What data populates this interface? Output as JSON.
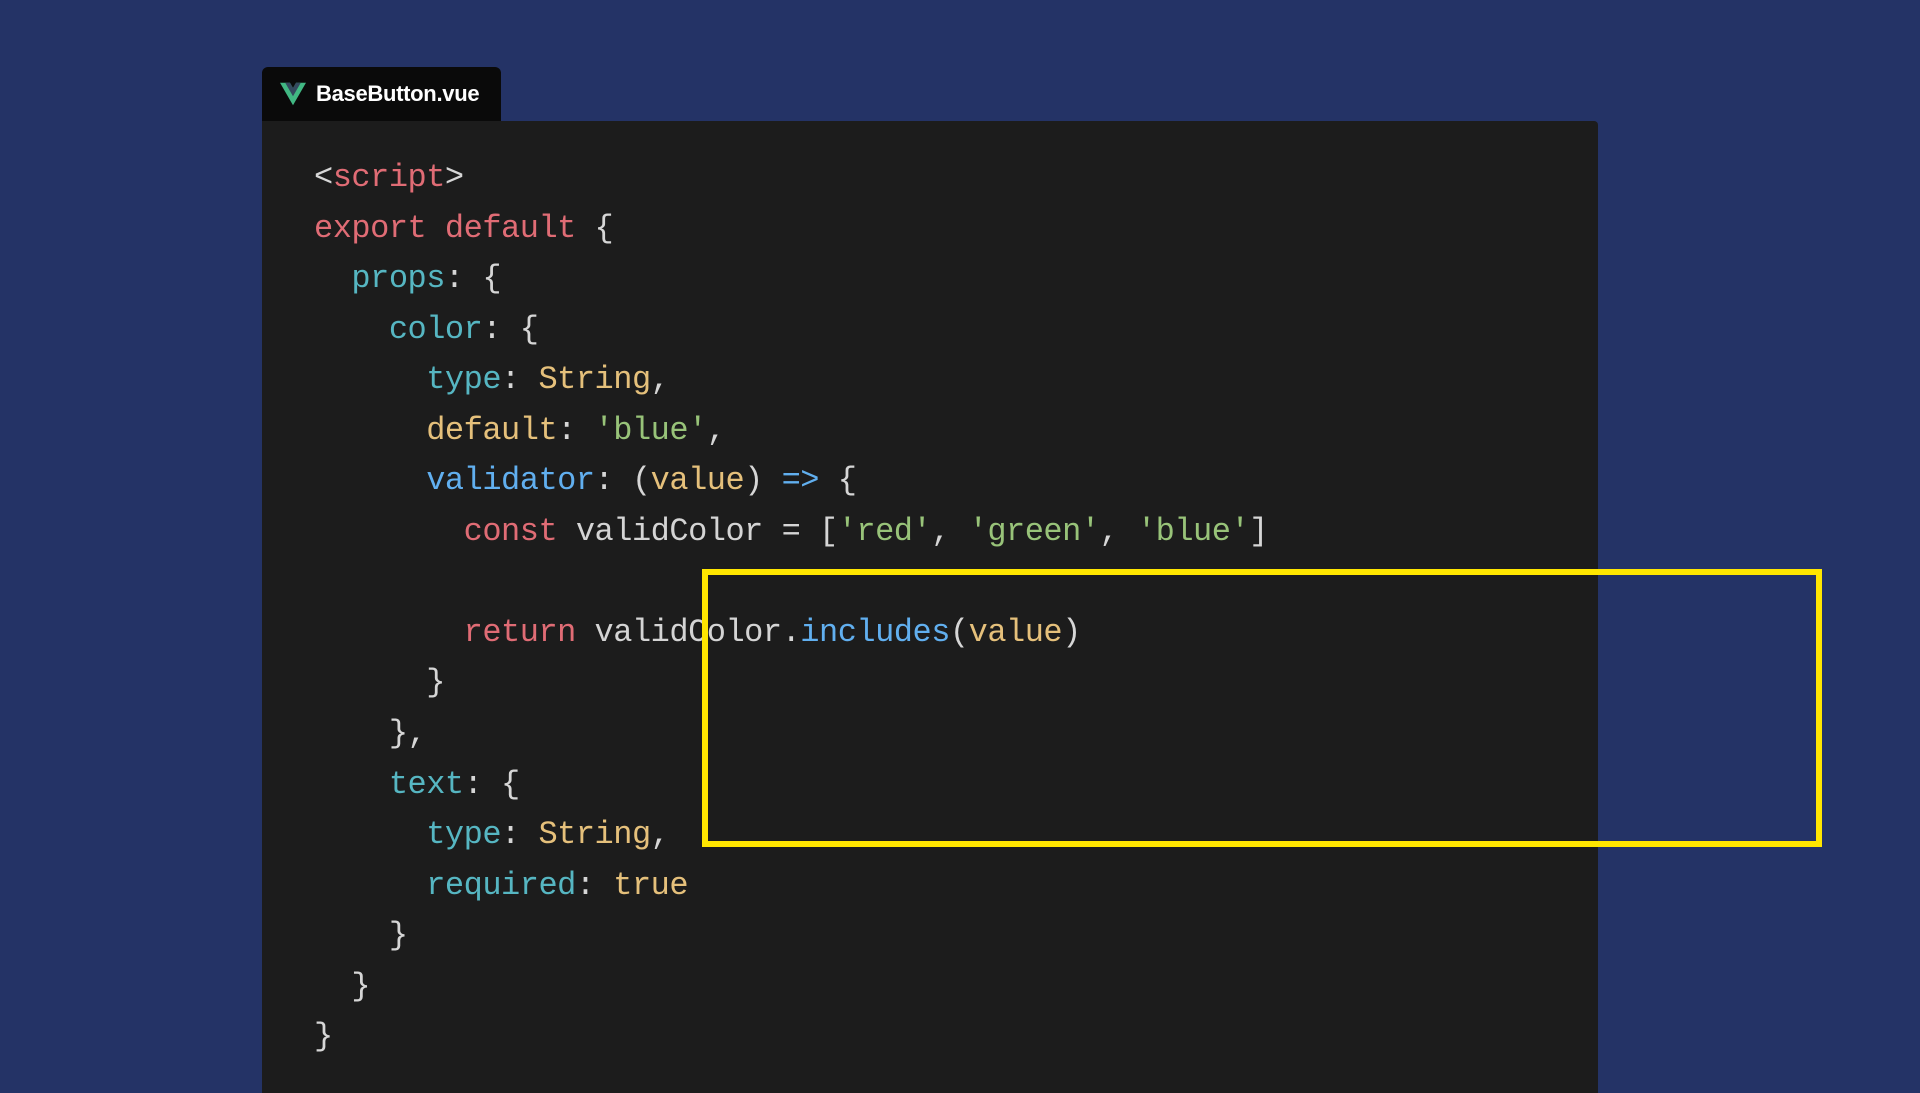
{
  "tab": {
    "filename": "BaseButton.vue"
  },
  "code": {
    "script_open_lt": "<",
    "script_open_name": "script",
    "script_open_gt": ">",
    "export_kw": "export",
    "default_kw": "default",
    "brace_open": " {",
    "props_key": "props",
    "colon_brace": ": {",
    "color_key": "color",
    "type_key": "type",
    "string_type": "String",
    "comma": ",",
    "default_prop": "default",
    "blue_str": "'blue'",
    "validator_key": "validator",
    "colon_paren": ": (",
    "value_param": "value",
    "paren_arrow": ") ",
    "arrow": "=>",
    "arrow_brace": " {",
    "const_kw": "const",
    "validColor_ident": "validColor",
    "eq_bracket": " = [",
    "red_str": "'red'",
    "green_str": "'green'",
    "blue_str2": "'blue'",
    "close_bracket": "]",
    "return_kw": "return",
    "dot": ".",
    "includes_method": "includes",
    "open_paren": "(",
    "close_paren": ")",
    "close_brace": "}",
    "close_brace_comma": "},",
    "text_key": "text",
    "required_key": "required",
    "true_bool": "true",
    "colon_sp": ": "
  }
}
